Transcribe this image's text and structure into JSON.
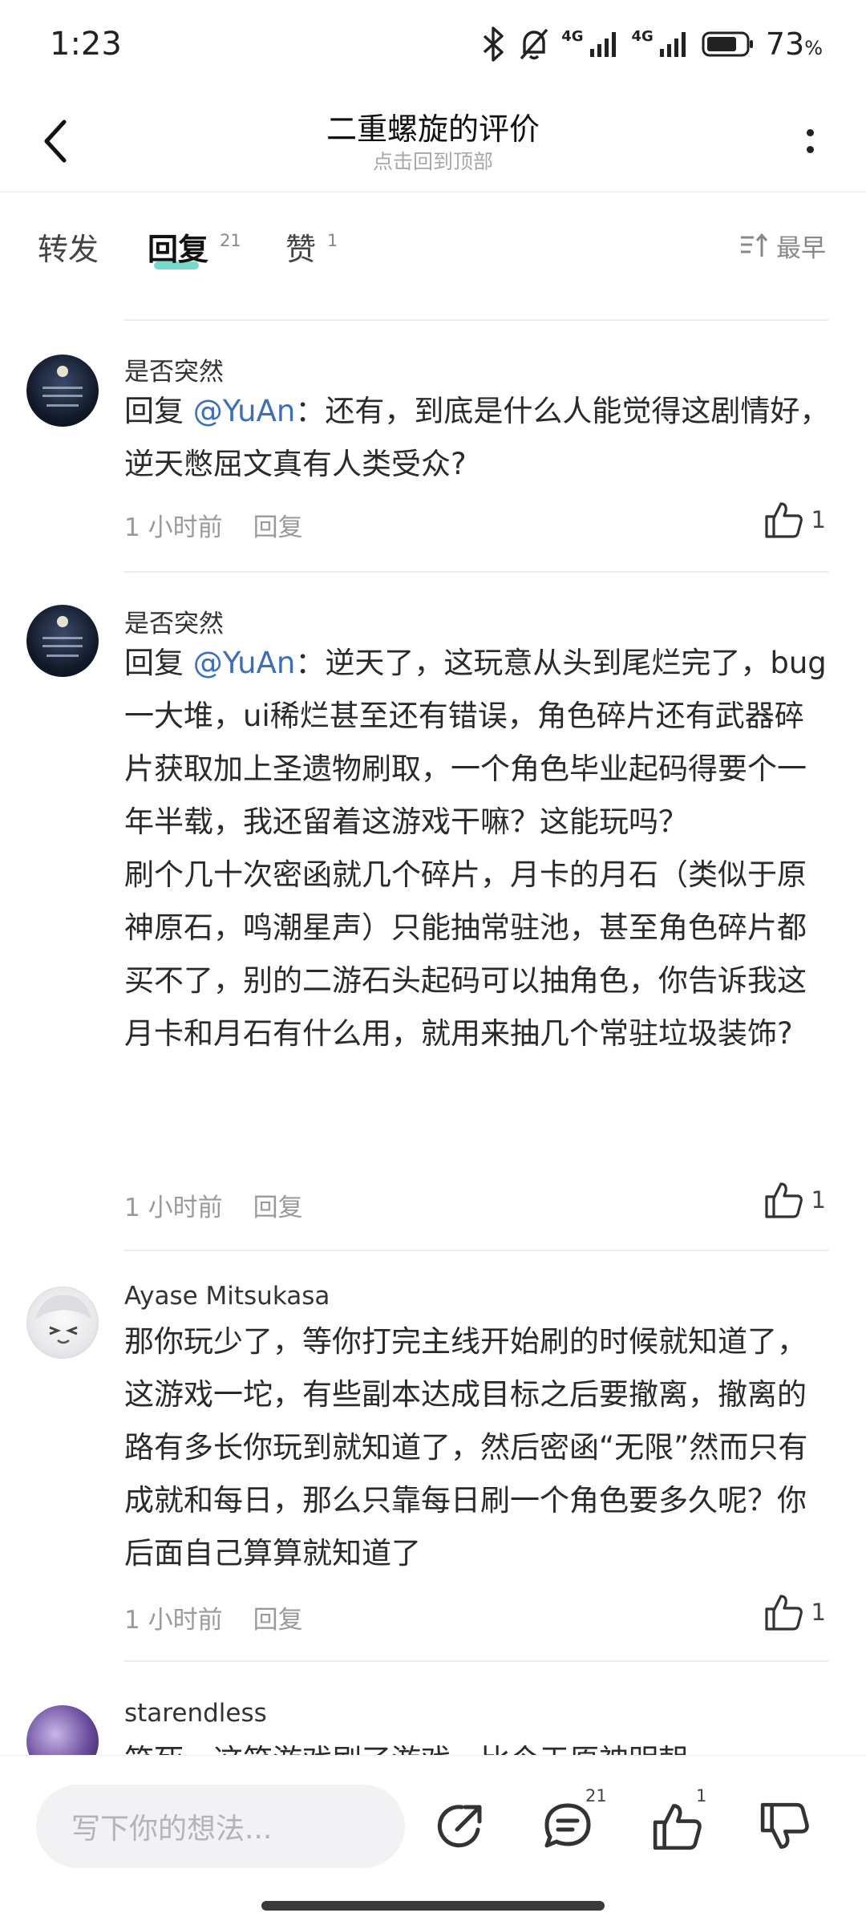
{
  "status_bar": {
    "time": "1:23",
    "net1": "4G",
    "net2": "4G",
    "battery_pct": "73",
    "battery_unit": "%",
    "icons": [
      "bluetooth-icon",
      "mute-bell-icon",
      "signal-icon",
      "signal-icon",
      "battery-icon"
    ]
  },
  "header": {
    "title": "二重螺旋的评价",
    "subtitle": "点击回到顶部"
  },
  "tabs": [
    {
      "label": "转发",
      "count": ""
    },
    {
      "label": "回复",
      "count": "21"
    },
    {
      "label": "赞",
      "count": "1"
    }
  ],
  "active_tab": "回复",
  "sort": {
    "label": "最早"
  },
  "comments": [
    {
      "author": "是否突然",
      "reply_prefix": "回复 ",
      "mention": "@YuAn",
      "text": "：还有，到底是什么人能觉得这剧情好，逆天憋屈文真有人类受众?",
      "time": "1 小时前",
      "reply_label": "回复",
      "likes": "1"
    },
    {
      "author": "是否突然",
      "reply_prefix": "回复 ",
      "mention": "@YuAn",
      "text": "：逆天了，这玩意从头到尾烂完了，bug一大堆，ui稀烂甚至还有错误，角色碎片还有武器碎片获取加上圣遗物刷取，一个角色毕业起码得要个一年半载，我还留着这游戏干嘛？这能玩吗？\n刷个几十次密函就几个碎片，月卡的月石（类似于原神原石，鸣潮星声）只能抽常驻池，甚至角色碎片都买不了，别的二游石头起码可以抽角色，你告诉我这月卡和月石有什么用，就用来抽几个常驻垃圾装饰?",
      "time": "1 小时前",
      "reply_label": "回复",
      "likes": "1"
    },
    {
      "author": "Ayase Mitsukasa",
      "text": "那你玩少了，等你打完主线开始刷的时候就知道了，这游戏一坨，有些副本达成目标之后要撤离，撤离的路有多长你玩到就知道了，然后密函“无限”然而只有成就和每日，那么只靠每日刷一个角色要多久呢？你后面自己算算就知道了",
      "time": "1 小时前",
      "reply_label": "回复",
      "likes": "1"
    },
    {
      "author": "starendless",
      "text": "笑死，这笑游戏刷了游戏，比今天原神明朝"
    }
  ],
  "bottom_bar": {
    "input_placeholder": "写下你的想法...",
    "comment_count": "21",
    "like_count": "1"
  }
}
